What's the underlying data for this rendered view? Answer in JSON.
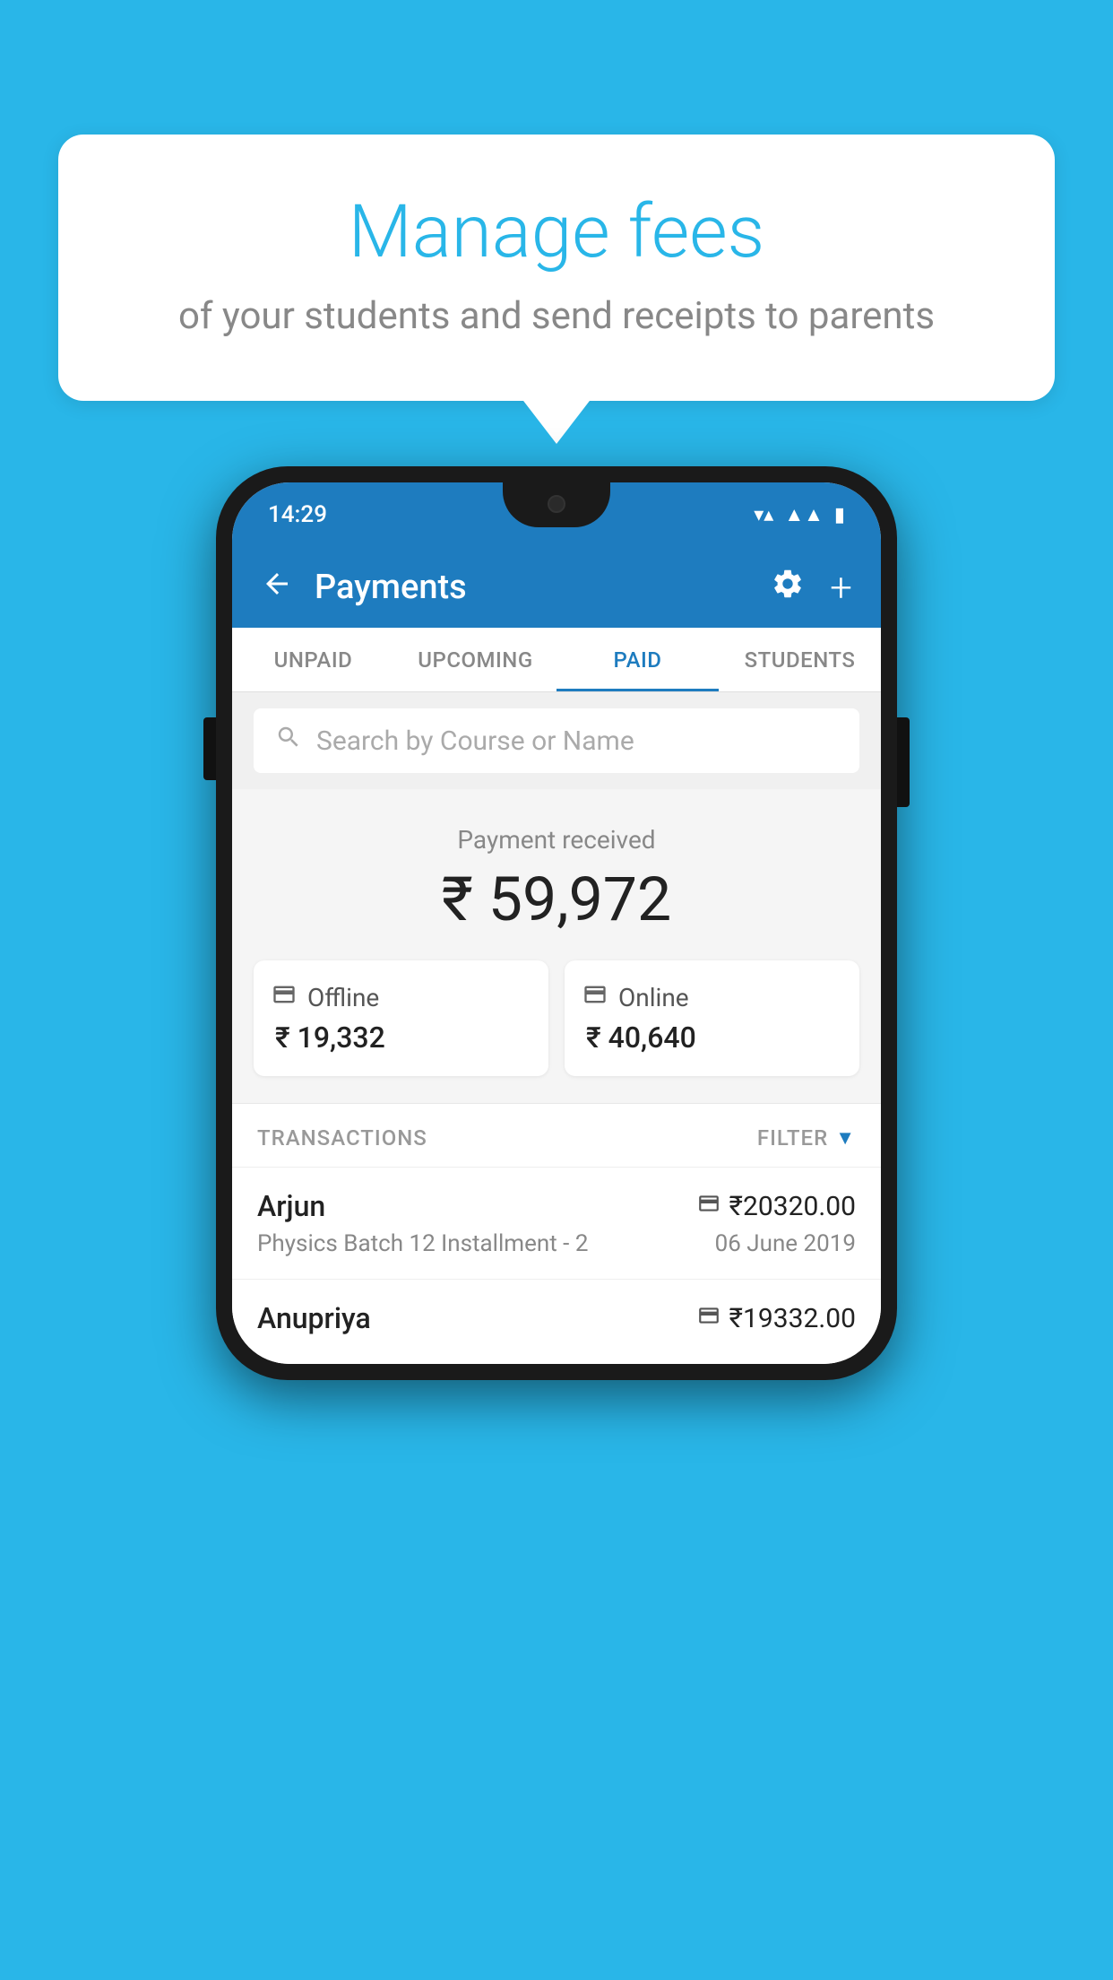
{
  "page": {
    "bg_color": "#29b6e8"
  },
  "bubble": {
    "title": "Manage fees",
    "subtitle": "of your students and send receipts to parents"
  },
  "status_bar": {
    "time": "14:29",
    "icons": [
      "wifi",
      "signal",
      "battery"
    ]
  },
  "header": {
    "title": "Payments",
    "back_label": "←",
    "settings_label": "⚙",
    "add_label": "+"
  },
  "tabs": [
    {
      "id": "unpaid",
      "label": "UNPAID",
      "active": false
    },
    {
      "id": "upcoming",
      "label": "UPCOMING",
      "active": false
    },
    {
      "id": "paid",
      "label": "PAID",
      "active": true
    },
    {
      "id": "students",
      "label": "STUDENTS",
      "active": false
    }
  ],
  "search": {
    "placeholder": "Search by Course or Name"
  },
  "payment_summary": {
    "received_label": "Payment received",
    "total_amount": "₹ 59,972",
    "offline_label": "Offline",
    "offline_amount": "₹ 19,332",
    "online_label": "Online",
    "online_amount": "₹ 40,640"
  },
  "transactions": {
    "header_label": "TRANSACTIONS",
    "filter_label": "FILTER",
    "rows": [
      {
        "name": "Arjun",
        "amount": "₹20320.00",
        "course": "Physics Batch 12 Installment - 2",
        "date": "06 June 2019",
        "payment_type": "online"
      },
      {
        "name": "Anupriya",
        "amount": "₹19332.00",
        "course": "",
        "date": "",
        "payment_type": "offline"
      }
    ]
  }
}
